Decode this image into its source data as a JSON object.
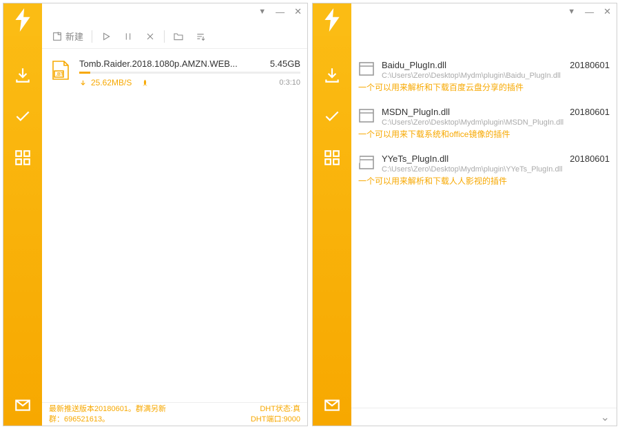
{
  "toolbar": {
    "new_label": "新建"
  },
  "download": {
    "name": "Tomb.Raider.2018.1080p.AMZN.WEB...",
    "size": "5.45GB",
    "speed": "25.62MB/S",
    "time": "0:3:10",
    "progress_pct": 5
  },
  "statusbar": {
    "left_line1": "最新推送版本20180601。群满另新",
    "left_line2": "群：696521613。",
    "right_line1": "DHT状态:真",
    "right_line2": "DHT端口:9000"
  },
  "plugins": [
    {
      "name": "Baidu_PlugIn.dll",
      "date": "20180601",
      "path": "C:\\Users\\Zero\\Desktop\\Mydm\\plugin\\Baidu_PlugIn.dll",
      "desc": "一个可以用来解析和下载百度云盘分享的插件"
    },
    {
      "name": "MSDN_PlugIn.dll",
      "date": "20180601",
      "path": "C:\\Users\\Zero\\Desktop\\Mydm\\plugin\\MSDN_PlugIn.dll",
      "desc": "一个可以用来下载系统和office镜像的插件"
    },
    {
      "name": "YYeTs_PlugIn.dll",
      "date": "20180601",
      "path": "C:\\Users\\Zero\\Desktop\\Mydm\\plugin\\YYeTs_PlugIn.dll",
      "desc": "一个可以用来解析和下载人人影视的插件"
    }
  ]
}
